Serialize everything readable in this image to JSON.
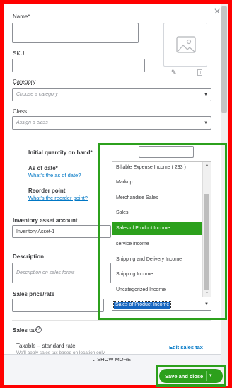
{
  "form": {
    "name_label": "Name*",
    "sku_label": "SKU",
    "category_label": "Category",
    "category_placeholder": "Choose a category",
    "class_label": "Class",
    "class_placeholder": "Assign a class",
    "initial_qty_label": "Initial quantity on hand*",
    "as_of_label": "As of date*",
    "as_of_help": "What's the as of date?",
    "reorder_label": "Reorder point",
    "reorder_help": "What's the reorder point?",
    "inventory_account_label": "Inventory asset account",
    "inventory_account_value": "Inventory Asset-1",
    "description_label": "Description",
    "description_placeholder": "Description on sales forms",
    "sales_price_label": "Sales price/rate",
    "sales_tax_label": "Sales tax",
    "sales_tax_value": "Taxable – standard rate",
    "sales_tax_sub": "We'll apply sales tax based on location only",
    "edit_sales_tax": "Edit sales tax"
  },
  "income_dropdown": {
    "options": [
      "Billable Expense Income ( 233 )",
      "Markup",
      "Merchandise Sales",
      "Sales",
      "Sales of Product Income",
      "service income",
      "Shipping and Delivery Income",
      "Shipping Income",
      "Uncategorized Income"
    ],
    "selected": "Sales of Product Income"
  },
  "footer": {
    "show_more": "SHOW MORE",
    "save_label": "Save and close"
  },
  "colors": {
    "accent_green": "#2ca01c",
    "highlight_red": "#ff0000",
    "link_blue": "#0077c5"
  }
}
